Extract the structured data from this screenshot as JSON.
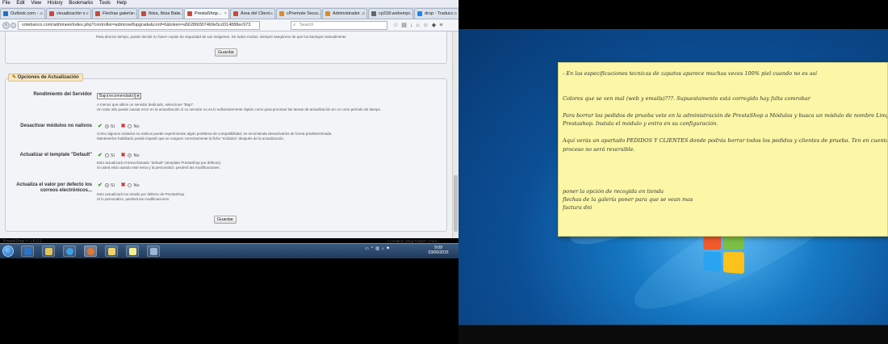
{
  "menu": [
    "File",
    "Edit",
    "View",
    "History",
    "Bookmarks",
    "Tools",
    "Help"
  ],
  "tabs": [
    {
      "label": "Outlook.com - ...",
      "color": "#1e70c8"
    },
    {
      "label": "visualización v...",
      "color": "#c84a3a"
    },
    {
      "label": "Flechas galería ...",
      "color": "#c84a3a"
    },
    {
      "label": "Ibiza, Ibiza Bale...",
      "color": "#c84a3a"
    },
    {
      "label": "PrestaShop...",
      "color": "#c84a3a",
      "active": true
    },
    {
      "label": "Área del Client...",
      "color": "#c84a3a"
    },
    {
      "label": "cPremote Secu...",
      "color": "#e08a22"
    },
    {
      "label": "Administrador ...",
      "color": "#e08a22"
    },
    {
      "label": "cp318.webemp...",
      "color": "#666666"
    },
    {
      "label": "drop - Traducc...",
      "color": "#1e88e5"
    }
  ],
  "nav": {
    "url": "votebanco.com/admineei/index.php?controller=adminselfupgrade&conf=6&token=a5628fd3074b9e5cd314888ec973",
    "search_placeholder": "Search"
  },
  "backup_section": {
    "hint": "Para ahorrar tiempo, puede decidir no hacer copias de seguridad de sus imágenes. De todos modos, siempre asegúrese de que los backups manualmente",
    "save_label": "Guardar"
  },
  "update_section": {
    "title": "Opciones de Actualización",
    "save_label": "Guardar",
    "yes_label": "Sí",
    "no_label": "No",
    "rows": [
      {
        "label": "Rendimiento del Servidor",
        "select_value": "Bajo(recomendado)",
        "hints": [
          "A menos que utilice un servidor dedicado, seleccione \"Bajo\".",
          "Un valor alto puede causar error en la actualización si su servidor no es lo suficientemente rápido como para procesar las tareas de actualización en un corto período de tiempo."
        ]
      },
      {
        "label": "Desactivar módulos no nativos",
        "selected": "yes",
        "hints": [
          "Como algunos módulos no nativos puede experimentar algún problema de compatibilidad, se recomienda desactivarlos de forma predeterminada.",
          "Mantenerlos habilitado puede impedir que se carguen correctamente la ficha \"módulos\" después de la actualización."
        ]
      },
      {
        "label": "Actualizar el template \"Default\"",
        "selected": "no",
        "hints": [
          "Esto actualizará el tema llamado \"default\" (template PrestaShop por defecto).",
          "Si usted está usando este tema y la personalizó, perderá las modificaciones."
        ]
      },
      {
        "label_lines": [
          "Actualiza el valor por defecto los",
          "correos electrónicos..."
        ],
        "selected": "yes",
        "hints": [
          "Esto actualizará los emails por defecto de PrestaShop.",
          "Si lo personalizo, perderá las modificaciones."
        ]
      }
    ]
  },
  "footer": {
    "version": "PrestaShop™ 1.6.0.2",
    "right": "| Contacto | Bug Tracker | Foro |"
  },
  "taskbar": {
    "time": "9:09",
    "date": "03/06/2015"
  },
  "sticky_note": {
    "lines": [
      "- En las especificaciones tecnicas de zapatos aparece muchas veces 100% piel cuando no es así",
      "",
      "",
      "Colores que se ven mal (web y emails)???. Supuestamente está corregido hay falta comrobar",
      "",
      "Para borrar los pedidos de prueba vete en la administración de PrestaShop a Módulos y busca un módulo de nombre Limpiador",
      "Prestashop. Instala el módulo y entra en su configuración.",
      "",
      "Aquí verás un apartado PEDIDOS Y CLIENTES donde podrás borrar todos los pedidos y clientes de prueba. Ten en cuenta que este",
      "proceso no será reversible.",
      "",
      "",
      "",
      "",
      "poner la opción de recogida en tienda",
      "flechas de la galería poner para que se vean mas",
      "factura dni"
    ]
  }
}
